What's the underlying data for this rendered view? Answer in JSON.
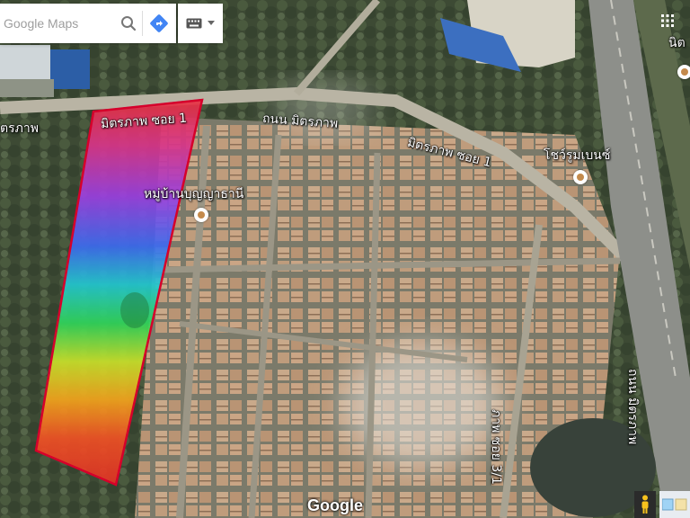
{
  "search": {
    "placeholder": "Google Maps"
  },
  "icons": {
    "search": "search-icon",
    "directions": "directions-icon",
    "keyboard": "keyboard-icon",
    "dropdown": "chevron-down-icon",
    "apps": "apps-grid-icon",
    "poi": "place-pin-icon",
    "pegman": "pegman-icon"
  },
  "labels": {
    "road_left": "ตรภาพ",
    "parcel": "มิตรภาพ ซอย 1",
    "road_main": "ถนน มิตรภาพ",
    "village": "หมู่บ้านบุญญาธานี",
    "soi_right": "มิตรภาพ ซอย 1",
    "showroom": "โชว์รูมเบนซ์",
    "highway_vertical": "ถนน มิตรภาพ",
    "corner_top": "นิต",
    "soi_bottom": "ภาพ ซอย 3/1"
  },
  "brand": {
    "logo": "Google"
  },
  "colors": {
    "parcel_border": "#d6002a",
    "parcel_outline_top": "#3a2cff",
    "accent_directions": "#4285f4"
  }
}
